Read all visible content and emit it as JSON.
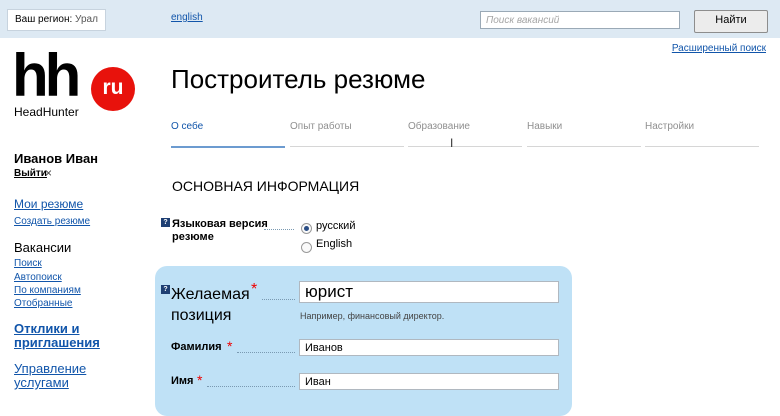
{
  "topbar": {
    "region_label": "Ваш регион:",
    "region_value": "Урал",
    "language_link": "english",
    "search_placeholder": "Поиск вакансий",
    "search_button": "Найти",
    "advanced_search": "Расширенный поиск"
  },
  "logo": {
    "mark": "hh",
    "badge": "ru",
    "brand": "HeadHunter"
  },
  "sidebar": {
    "user_name": "Иванов Иван",
    "logout": "Выйти",
    "logout_x": "×",
    "my_resumes": "Мои резюме",
    "create_resume": "Создать резюме",
    "vacancies_heading": "Вакансии",
    "vacancy_links": [
      "Поиск",
      "Автопоиск",
      "По компаниям",
      "Отобранные"
    ],
    "responses_line1": "Отклики и",
    "responses_line2": "приглашения",
    "services_line1": "Управление",
    "services_line2": "услугами"
  },
  "main": {
    "title": "Построитель резюме",
    "steps": [
      "О себе",
      "Опыт работы",
      "Образование",
      "Навыки",
      "Настройки"
    ],
    "active_step": 0,
    "section_title": "ОСНОВНАЯ ИНФОРМАЦИЯ",
    "help_glyph": "?",
    "language_version_label": "Языковая версия резюме",
    "language_options": [
      "русский",
      "English"
    ],
    "language_selected": "русский",
    "position_label": "Желаемая позиция",
    "position_value": "юрист",
    "position_hint": "Например, финансовый директор.",
    "surname_label": "Фамилия",
    "surname_value": "Иванов",
    "name_label": "Имя",
    "name_value": "Иван",
    "required_mark": "*"
  },
  "colors": {
    "link": "#1155aa",
    "topbar": "#dde9f3",
    "panel": "#bfe1f6",
    "logo_red": "#e8120c",
    "required": "#e00000"
  }
}
